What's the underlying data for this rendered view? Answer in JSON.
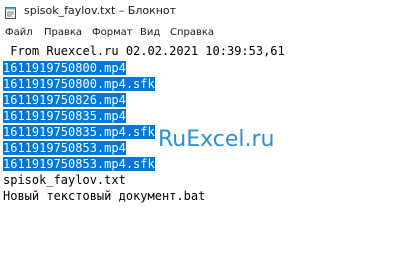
{
  "window": {
    "title": "spisok_faylov.txt – Блокнот",
    "icon": "notepad-icon"
  },
  "menu": [
    "Файл",
    "Правка",
    "Формат",
    "Вид",
    "Справка"
  ],
  "editor": {
    "header_line": " From Ruexcel.ru 02.02.2021 10:39:53,61",
    "selected_lines": [
      "1611919750800.mp4",
      "1611919750800.mp4.sfk",
      "1611919750826.mp4",
      "1611919750835.mp4",
      "1611919750835.mp4.sfk",
      "1611919750853.mp4",
      "1611919750853.mp4.sfk"
    ],
    "plain_lines": [
      "spisok_faylov.txt",
      "Новый текстовый документ.bat"
    ]
  },
  "watermark": "RuExcel.ru",
  "colors": {
    "selection": "#0078d7",
    "selection_text": "#ffffff",
    "watermark": "#2e8fd6"
  }
}
